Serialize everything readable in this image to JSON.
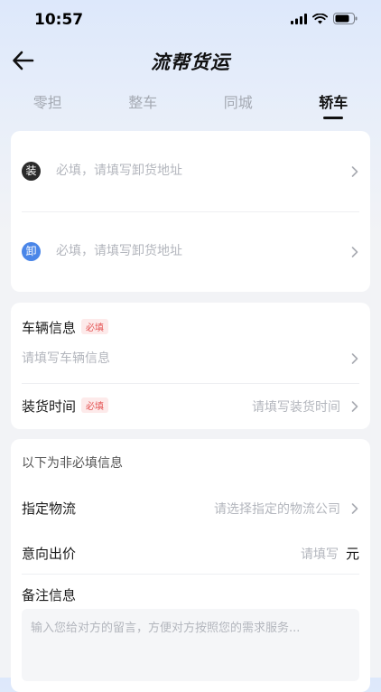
{
  "status": {
    "time": "10:57"
  },
  "header": {
    "title": "流帮货运"
  },
  "tabs": [
    {
      "label": "零担"
    },
    {
      "label": "整车"
    },
    {
      "label": "同城"
    },
    {
      "label": "轿车"
    }
  ],
  "address": {
    "load": {
      "badge": "装",
      "placeholder": "必填，请填写卸货地址"
    },
    "unload": {
      "badge": "卸",
      "placeholder": "必填，请填写卸货地址"
    }
  },
  "vehicle": {
    "label": "车辆信息",
    "required": "必填",
    "placeholder": "请填写车辆信息"
  },
  "loading_time": {
    "label": "装货时间",
    "required": "必填",
    "placeholder": "请填写装货时间"
  },
  "optional": {
    "note": "以下为非必填信息",
    "logistics": {
      "label": "指定物流",
      "placeholder": "请选择指定的物流公司"
    },
    "price": {
      "label": "意向出价",
      "placeholder": "请填写",
      "unit": "元"
    },
    "remarks": {
      "label": "备注信息",
      "placeholder": "输入您给对方的留言，方便对方按照您的需求服务..."
    }
  },
  "colors": {
    "accent_blue": "#4a86e8",
    "required_red": "#e45252"
  }
}
